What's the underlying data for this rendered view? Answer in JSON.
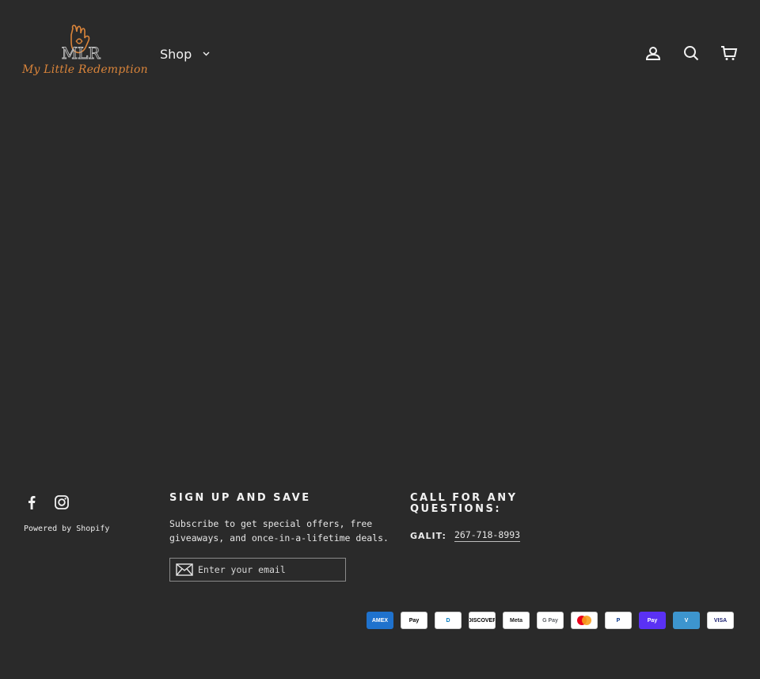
{
  "header": {
    "logo": {
      "monogram": "MLR",
      "text": "My Little Redemption",
      "color": "#d9843a"
    },
    "nav": {
      "shop_label": "Shop"
    },
    "icons": [
      "account-icon",
      "search-icon",
      "cart-icon"
    ]
  },
  "footer": {
    "powered_by": "Powered by Shopify",
    "social": [
      "facebook-icon",
      "instagram-icon"
    ],
    "signup": {
      "title": "Sign up and save",
      "text": "Subscribe to get special offers, free giveaways, and once-in-a-lifetime deals.",
      "email_placeholder": "Enter your email"
    },
    "contact": {
      "title": "Call for any questions:",
      "label": "GALIT:",
      "phone": "267-718-8993"
    },
    "payments": [
      {
        "name": "American Express",
        "short": "AMEX",
        "bg": "#1f72cd",
        "fg": "#ffffff"
      },
      {
        "name": "Apple Pay",
        "short": "Pay",
        "bg": "#ffffff",
        "fg": "#000000"
      },
      {
        "name": "Diners Club",
        "short": "D",
        "bg": "#ffffff",
        "fg": "#0079be"
      },
      {
        "name": "Discover",
        "short": "DISCOVER",
        "bg": "#ffffff",
        "fg": "#000000"
      },
      {
        "name": "Meta Pay",
        "short": "Meta",
        "bg": "#ffffff",
        "fg": "#1c1c1c"
      },
      {
        "name": "Google Pay",
        "short": "G Pay",
        "bg": "#ffffff",
        "fg": "#5f6368"
      },
      {
        "name": "Mastercard",
        "short": "",
        "bg": "#ffffff",
        "fg": "#000000"
      },
      {
        "name": "PayPal",
        "short": "P",
        "bg": "#ffffff",
        "fg": "#003087"
      },
      {
        "name": "Shop Pay",
        "short": "Pay",
        "bg": "#5a31f4",
        "fg": "#ffffff"
      },
      {
        "name": "Venmo",
        "short": "V",
        "bg": "#3d95ce",
        "fg": "#ffffff"
      },
      {
        "name": "Visa",
        "short": "VISA",
        "bg": "#ffffff",
        "fg": "#1a1f71"
      }
    ]
  },
  "colors": {
    "background": "#2a2a2a",
    "text": "#ececec",
    "accent": "#d9843a"
  }
}
